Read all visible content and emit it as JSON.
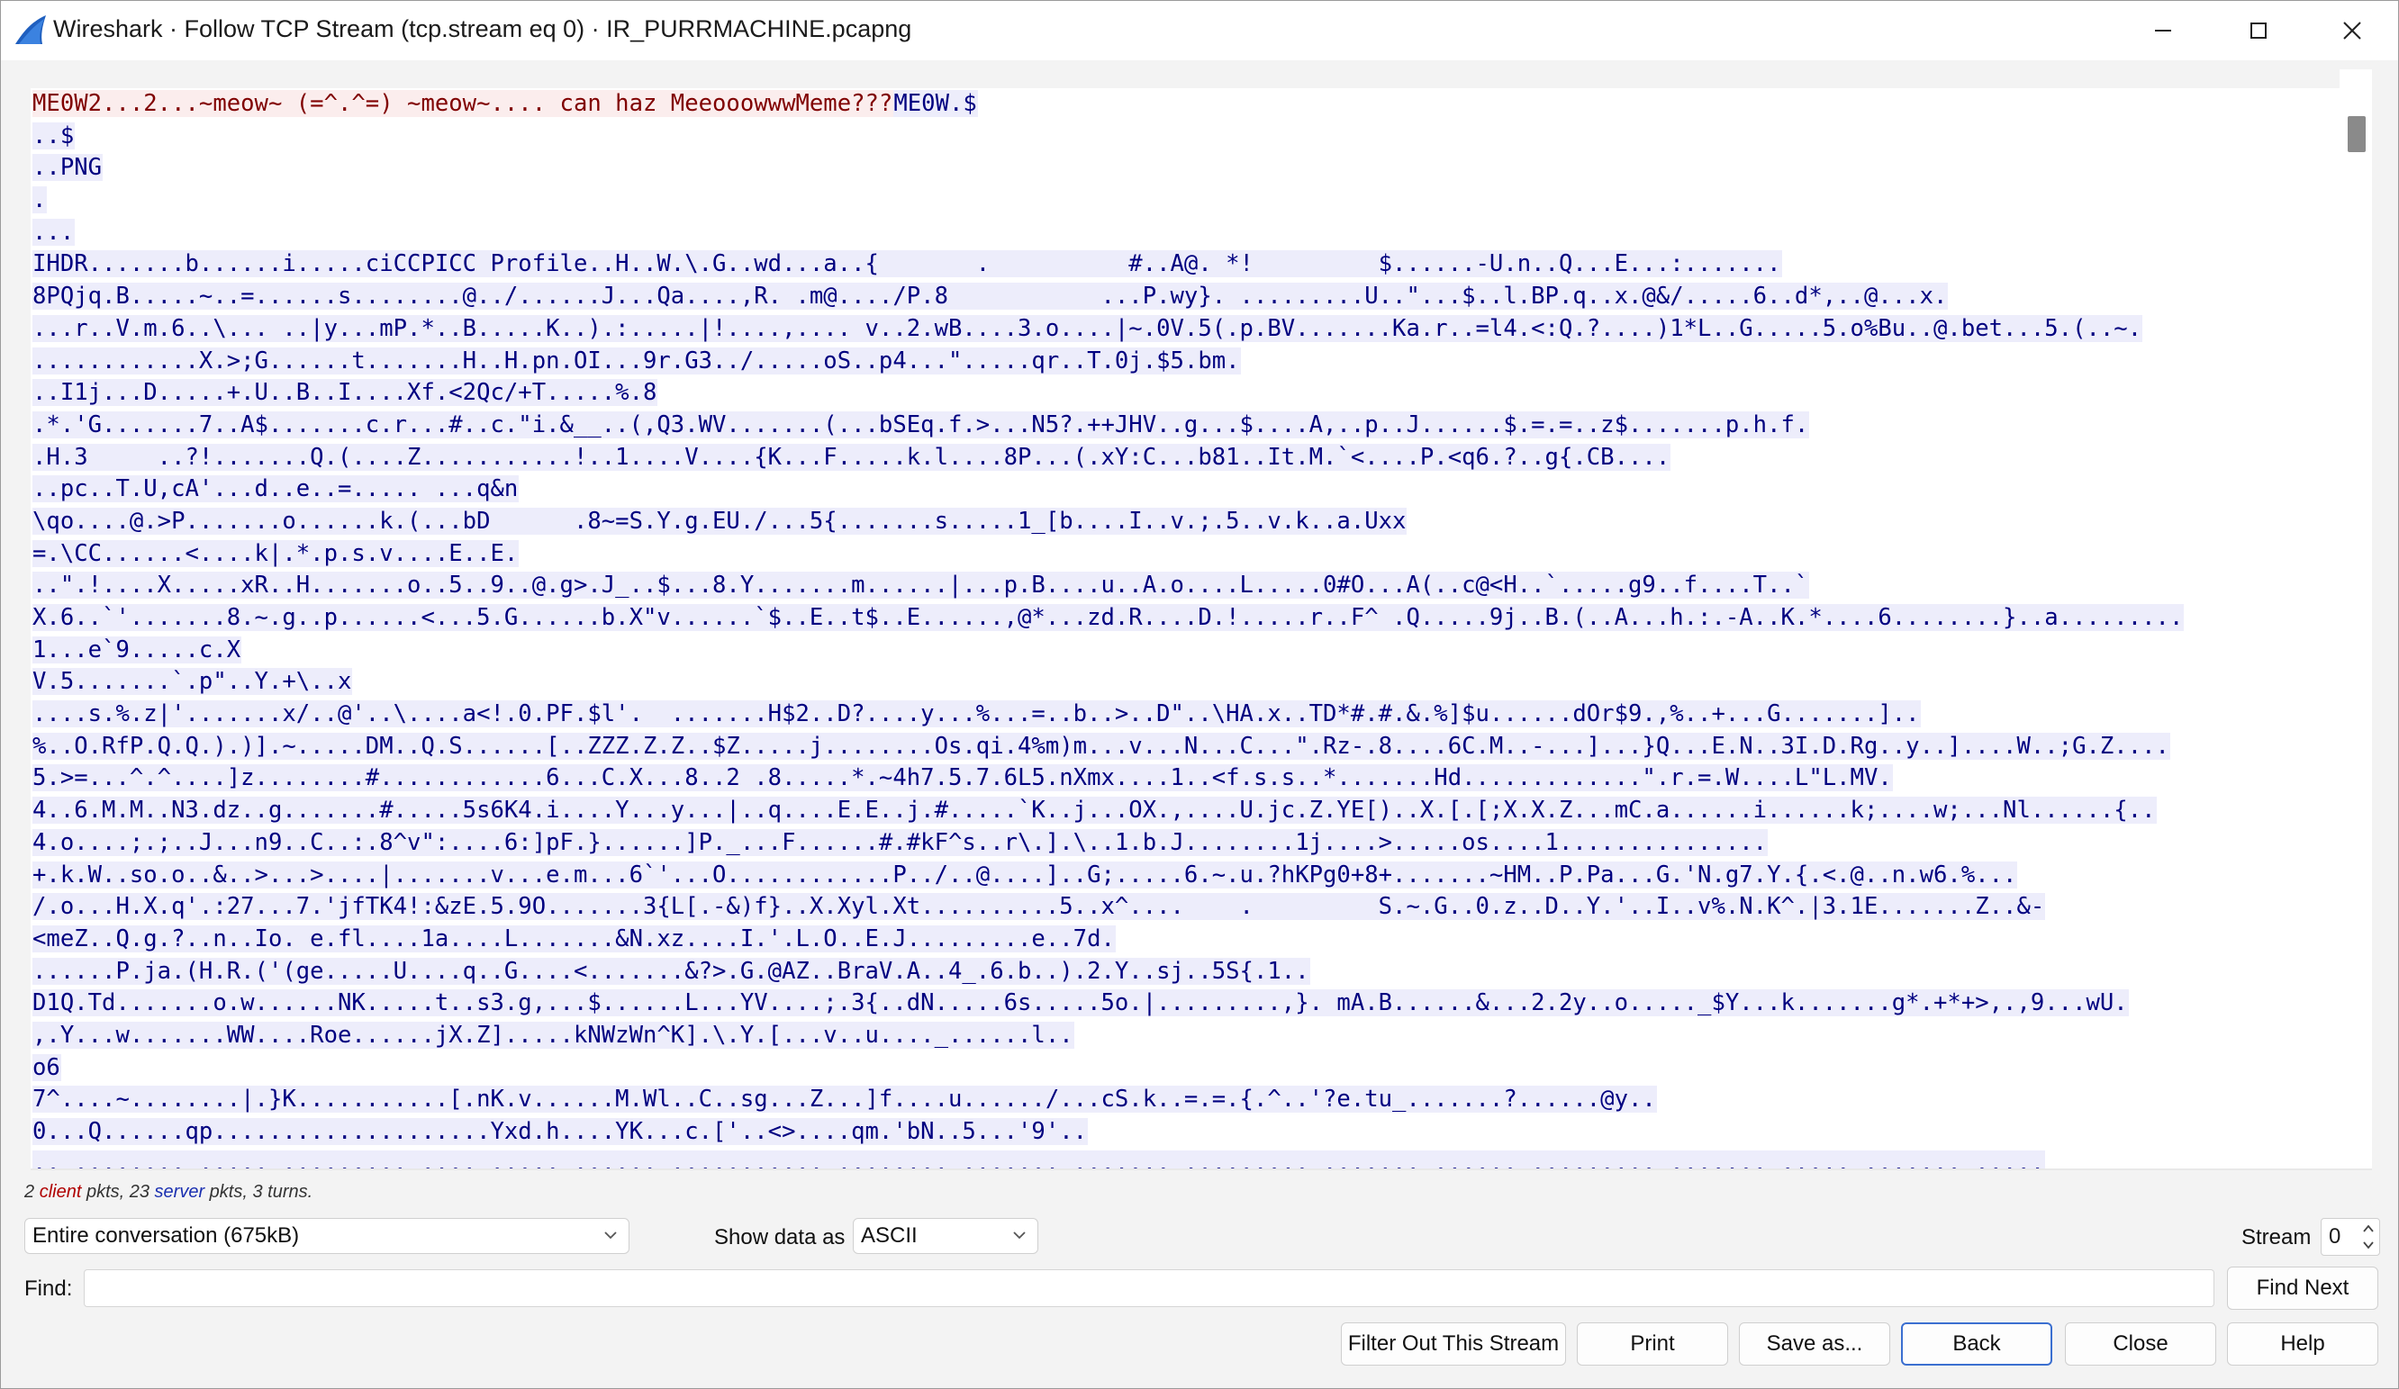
{
  "window": {
    "title": "Wireshark · Follow TCP Stream (tcp.stream eq 0) · IR_PURRMACHINE.pcapng",
    "minimize_icon": "minimize-icon",
    "maximize_icon": "maximize-icon",
    "close_icon": "close-icon"
  },
  "colors": {
    "client_fg": "#800000",
    "client_bg": "#fbeded",
    "server_fg": "#000080",
    "server_bg": "#ededfb"
  },
  "stream": {
    "lines": [
      {
        "segs": [
          {
            "dir": "client",
            "text": "ME0W2...2...~meow~ (=^.^=) ~meow~.... can haz MeeooowwwMeme???"
          },
          {
            "dir": "server",
            "text": "ME0W.$"
          }
        ]
      },
      {
        "segs": [
          {
            "dir": "server",
            "text": "..$"
          }
        ]
      },
      {
        "segs": [
          {
            "dir": "server",
            "text": "..PNG"
          }
        ]
      },
      {
        "segs": [
          {
            "dir": "server",
            "text": "."
          }
        ]
      },
      {
        "segs": [
          {
            "dir": "server",
            "text": "..."
          }
        ]
      },
      {
        "segs": [
          {
            "dir": "server",
            "text": "IHDR.......b......i.....ciCCPICC Profile..H..W.\\.G..wd...a..{       .          #..A@. *!         $......-U.n..Q...E...:......."
          }
        ]
      },
      {
        "segs": [
          {
            "dir": "server",
            "text": "8PQjq.B.....~..=......s........@../......J...Qa....,R. .m@..../P.8           ...P.wy}. .........U..\"...$..l.BP.q..x.@&/.....6..d*,..@...x."
          }
        ]
      },
      {
        "segs": [
          {
            "dir": "server",
            "text": "...r..V.m.6..\\... ..|y...mP.*..B.....K..).:.....|!....,.... v..2.wB....3.o....|~.0V.5(.p.BV.......Ka.r..=l4.<:Q.?....)1*L..G.....5.o%Bu..@.bet...5.(..~."
          }
        ]
      },
      {
        "segs": [
          {
            "dir": "server",
            "text": "............X.>;G......t.......H..H.pn.OI...9r.G3../.....oS..p4...\".....qr..T.0j.$5.bm."
          }
        ]
      },
      {
        "segs": [
          {
            "dir": "server",
            "text": "..I1j...D.....+.U..B..I....Xf.<2Qc/+T.....%.8"
          }
        ]
      },
      {
        "segs": [
          {
            "dir": "server",
            "text": ".*.'G.......7..A$.......c.r...#..c.\"i.&__..(,Q3.WV.......(...bSEq.f.>...N5?.++JHV..g...$....A,..p..J......$.=.=..z$.......p.h.f."
          }
        ]
      },
      {
        "segs": [
          {
            "dir": "server",
            "text": ".H.3     ..?!.......Q.(....Z...........!..1....V....{K...F.....k.l....8P...(.xY:C...b81..It.M.`<....P.<q6.?..g{.CB...."
          }
        ]
      },
      {
        "segs": [
          {
            "dir": "server",
            "text": "..pc..T.U,cA'...d..e..=..... ...q&n"
          }
        ]
      },
      {
        "segs": [
          {
            "dir": "server",
            "text": "\\qo....@.>P.......o......k.(...bD      .8~=S.Y.g.EU./...5{.......s.....1_[b....I..v.;.5..v.k..a.Uxx"
          }
        ]
      },
      {
        "segs": [
          {
            "dir": "server",
            "text": "=.\\CC......<....k|.*.p.s.v....E..E."
          }
        ]
      },
      {
        "segs": [
          {
            "dir": "server",
            "text": "..\".!....X.....xR..H.......o..5..9..@.g>.J_..$...8.Y.......m......|...p.B....u..A.o....L.....0#O...A(..c@<H..`.....g9..f....T..`"
          }
        ]
      },
      {
        "segs": [
          {
            "dir": "server",
            "text": "X.6..`'.......8.~.g..p......<...5.G......b.X\"v......`$..E..t$..E......,@*...zd.R....D.!.....r..F^ .Q.....9j..B.(..A...h.:.-A..K.*....6........}..a........."
          }
        ]
      },
      {
        "segs": [
          {
            "dir": "server",
            "text": "1...e`9.....c.X"
          }
        ]
      },
      {
        "segs": [
          {
            "dir": "server",
            "text": "V.5.......`.p\"..Y.+\\..x"
          }
        ]
      },
      {
        "segs": [
          {
            "dir": "server",
            "text": "....s.%.z|'.......x/..@'..\\....a<!.0.PF.$l'.  .......H$2..D?....y...%...=..b..>..D\"..\\HA.x..TD*#.#.&.%]$u......dOr$9.,%..+...G.......].."
          }
        ]
      },
      {
        "segs": [
          {
            "dir": "server",
            "text": "%..O.RfP.Q.Q.).)].~.....DM..Q.S......[..ZZZ.Z.Z..$Z.....j........Os.qi.4%m)m...v...N...C...\".Rz-.8....6C.M..-...]...}Q...E.N..3I.D.Rg..y..]....W..;G.Z...."
          }
        ]
      },
      {
        "segs": [
          {
            "dir": "server",
            "text": "5.>=...^.^....]z........#............6...C.X...8..2 .8.....*.~4h7.5.7.6L5.nXmx....1..<f.s.s..*.......Hd.............\".r.=.W....L\"L.MV."
          }
        ]
      },
      {
        "segs": [
          {
            "dir": "server",
            "text": "4..6.M.M..N3.dz..g.......#.....5s6K4.i....Y...y...|..q....E.E..j.#.....`K..j...OX.,....U.jc.Z.YE[)..X.[.[;X.X.Z...mC.a......i......k;....w;...Nl......{.."
          }
        ]
      },
      {
        "segs": [
          {
            "dir": "server",
            "text": "4.o....;.;..J...n9..C..:.8^v\":....6:]pF.}......]P._...F......#.#kF^s..r\\.].\\..1.b.J........1j....>.....os....1..............."
          }
        ]
      },
      {
        "segs": [
          {
            "dir": "server",
            "text": "+.k.W..so.o..&..>...>....|.......v...e.m...6`'...O............P../..@....]..G;.....6.~.u.?hKPg0+8+.......~HM..P.Pa...G.'N.g7.Y.{.<.@..n.w6.%..."
          }
        ]
      },
      {
        "segs": [
          {
            "dir": "server",
            "text": "/.o...H.X.q'.:27...7.'jfTK4!:&zE.5.9O.......3{L[.-&)f}..X.Xyl.Xt..........5..x^....    .         S.~.G..0.z..D..Y.'..I..v%.N.K^.|3.1E.......Z..&-"
          }
        ]
      },
      {
        "segs": [
          {
            "dir": "server",
            "text": "<meZ..Q.g.?..n..Io. e.fl....1a....L.......&N.xz....I.'.L.O..E.J.........e..7d."
          }
        ]
      },
      {
        "segs": [
          {
            "dir": "server",
            "text": "......P.ja.(H.R.('(ge.....U....q..G....<.......&?>.G.@AZ..BraV.A..4_.6.b..).2.Y..sj..5S{.1.."
          }
        ]
      },
      {
        "segs": [
          {
            "dir": "server",
            "text": "D1Q.Td.......o.w......NK.....t..s3.g,...$......L...YV....;.3{..dN.....6s.....5o.|.........,}. mA.B......&...2.2y..o....._$Y...k.......g*.+*+>,.,9...wU."
          }
        ]
      },
      {
        "segs": [
          {
            "dir": "server",
            "text": ",.Y...w.......WW....Roe......jX.Z].....kNWzWn^K].\\.Y.[...v..u...._......l.."
          }
        ]
      },
      {
        "segs": [
          {
            "dir": "server",
            "text": "o6"
          }
        ]
      },
      {
        "segs": [
          {
            "dir": "server",
            "text": "7^....~........|.}K...........[.nK.v......M.Wl..C..sg...Z...]f....u....../...cS.k..=.=.{.^..'?e.tu_.......?......@y.."
          }
        ]
      },
      {
        "segs": [
          {
            "dir": "server",
            "text": "0...Q......qp....................Yxd.h....YK...c.['..<>....qm.'bN..5...'9'.."
          }
        ]
      },
      {
        "segs": [
          {
            "dir": "server",
            "text": ".. ........ ..... ......... .... ..... ...... ........... ........ ....... ....... ......... ....... ...... ......... ....... ..... ....... ....."
          }
        ]
      }
    ]
  },
  "status": {
    "client_count": "2",
    "client_word": "client",
    "mid": " pkts, 23 ",
    "server_word": "server",
    "tail": " pkts, 3 turns."
  },
  "controls": {
    "conversation_select": "Entire conversation (675kB)",
    "show_data_label": "Show data as",
    "show_data_select": "ASCII",
    "stream_label": "Stream",
    "stream_value": "0",
    "find_label": "Find:",
    "find_value": "",
    "find_next": "Find Next"
  },
  "buttons": {
    "filter_out": "Filter Out This Stream",
    "print": "Print",
    "save_as": "Save as...",
    "back": "Back",
    "close": "Close",
    "help": "Help"
  }
}
